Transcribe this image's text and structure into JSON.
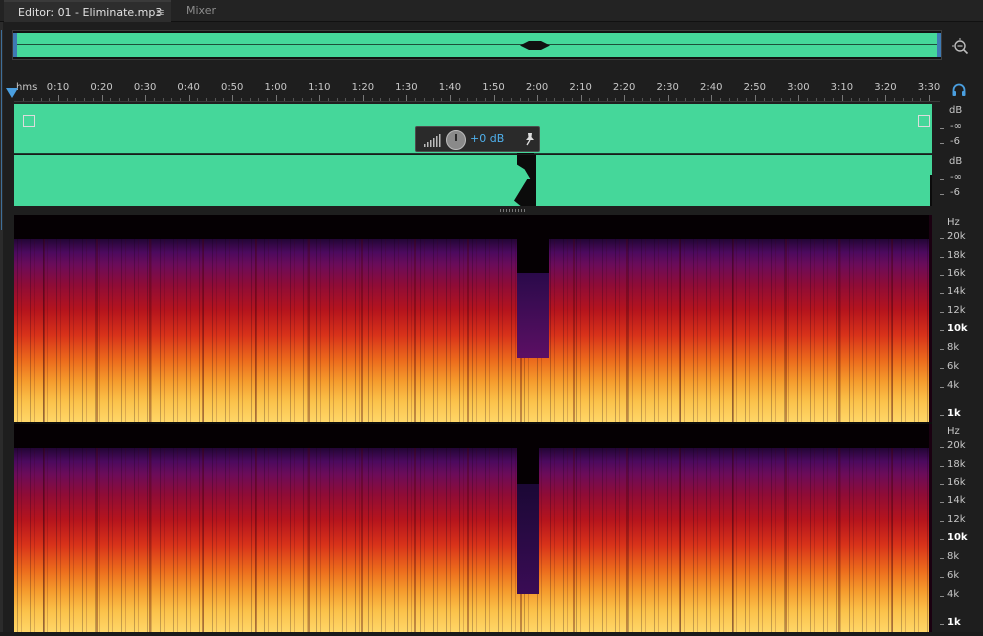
{
  "tabs": {
    "editor_label": "Editor: 01 - Eliminate.mp3",
    "editor_menu": "≡",
    "mixer_label": "Mixer"
  },
  "ruler": {
    "unit": "hms",
    "labels": [
      "0:10",
      "0:20",
      "0:30",
      "0:40",
      "0:50",
      "1:00",
      "1:10",
      "1:20",
      "1:30",
      "1:40",
      "1:50",
      "2:00",
      "2:10",
      "2:20",
      "2:30",
      "2:40",
      "2:50",
      "3:00",
      "3:10",
      "3:20",
      "3:30"
    ]
  },
  "hud": {
    "value": "+0 dB"
  },
  "db_scale": {
    "left": {
      "unit": "dB",
      "labels": [
        "-∞",
        "-6"
      ]
    },
    "right": {
      "unit": "dB",
      "labels": [
        "-∞",
        "-6"
      ]
    }
  },
  "hz_scale": {
    "unit": "Hz",
    "labels": [
      "20k",
      "18k",
      "16k",
      "14k",
      "12k",
      "10k",
      "8k",
      "6k",
      "4k",
      "1k"
    ],
    "bold_labels": [
      "10k",
      "1k"
    ]
  },
  "colors": {
    "waveform": "#45d79a",
    "accent": "#4a9fe0",
    "background": "#1e1e1e"
  },
  "icons": {
    "zoom": "zoom-icon",
    "headphones": "headphones-icon",
    "pin": "pin-icon",
    "knob": "knob-icon"
  }
}
